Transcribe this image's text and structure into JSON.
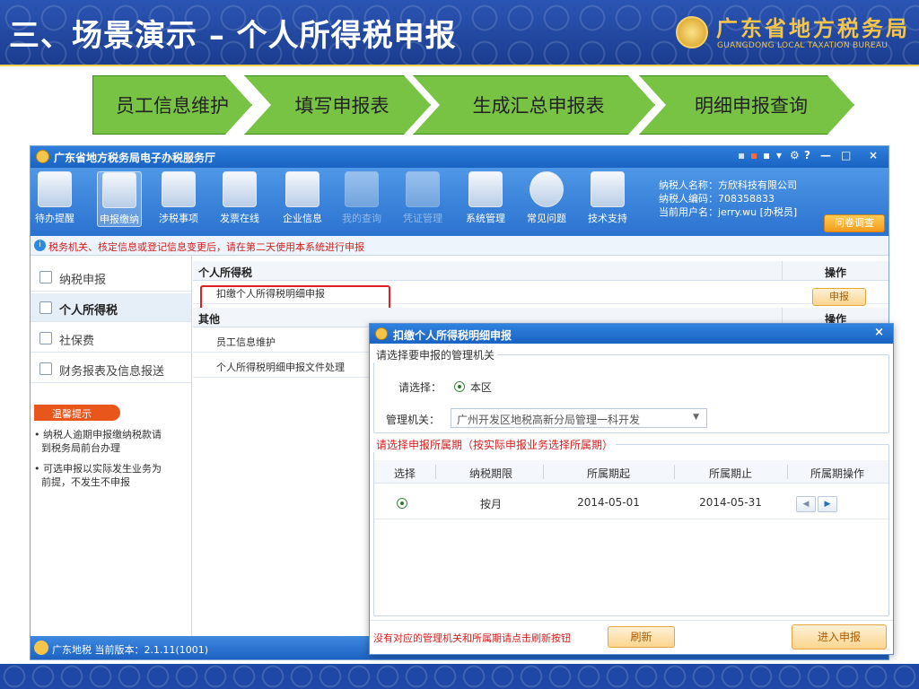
{
  "slide": {
    "title": "三、场景演示 – 个人所得税申报",
    "logo_cn": "广东省地方税务局",
    "logo_en": "GUANGDONG LOCAL TAXATION BUREAU"
  },
  "steps": [
    "员工信息维护",
    "填写申报表",
    "生成汇总申报表",
    "明细申报查询"
  ],
  "app": {
    "title": "广东省地方税务局电子办税服务厅",
    "window_controls": [
      "▪",
      "▪",
      "▪",
      "▾",
      "⚙",
      "?",
      "—",
      "□",
      "×"
    ],
    "toolbar": [
      {
        "label": "待办提醒",
        "icon": "clipboard-icon",
        "dim": false
      },
      {
        "label": "申报缴纳",
        "icon": "computer-icon",
        "dim": false,
        "active": true
      },
      {
        "label": "涉税事项",
        "icon": "document-icon",
        "dim": false
      },
      {
        "label": "发票在线",
        "icon": "stamp-icon",
        "dim": false
      },
      {
        "label": "企业信息",
        "icon": "building-icon",
        "dim": false
      },
      {
        "label": "我的查询",
        "icon": "magnifier-icon",
        "dim": true
      },
      {
        "label": "凭证管理",
        "icon": "folders-icon",
        "dim": true
      },
      {
        "label": "系统管理",
        "icon": "gear-icon",
        "dim": false
      },
      {
        "label": "常见问题",
        "icon": "question-icon",
        "dim": false
      },
      {
        "label": "技术支持",
        "icon": "support-agent-icon",
        "dim": false
      }
    ],
    "user_info": {
      "name_line": "纳税人名称：方欣科技有限公司",
      "code_line": "纳税人编码：708358833",
      "user_line": "当前用户名：jerry.wu [办税员]"
    },
    "survey_label": "问卷调查",
    "notice": "税务机关、核定信息或登记信息变更后，请在第二天使用本系统进行申报",
    "sidebar": [
      "纳税申报",
      "个人所得税",
      "社保费",
      "财务报表及信息报送"
    ],
    "tips": {
      "title": "温馨提示",
      "lines": [
        "• 纳税人逾期申报缴纳税款请",
        "到税务局前台办理",
        "• 可选申报以实际发生业务为",
        "前提，不发生不申报"
      ]
    },
    "main": {
      "section1": "个人所得税",
      "op_header": "操作",
      "row1": "扣缴个人所得税明细申报",
      "declare_label": "申报",
      "section2": "其他",
      "op_header2": "操作",
      "row2": "员工信息维护",
      "row3": "个人所得税明细申报文件处理"
    },
    "status": {
      "text": "广东地税  当前版本：2.1.11(1001)"
    }
  },
  "dialog": {
    "title": "扣缴个人所得税明细申报",
    "section1_legend": "请选择要申报的管理机关",
    "select_label": "请选择：",
    "radio_label": "本区",
    "org_label": "管理机关：",
    "org_value": "广州开发区地税高新分局管理一科开发",
    "section2_legend": "请选择申报所属期（按实际申报业务选择所属期）",
    "columns": [
      "选择",
      "纳税期限",
      "所属期起",
      "所属期止",
      "所属期操作"
    ],
    "rows": [
      {
        "period": "按月",
        "start": "2014-05-01",
        "end": "2014-05-31"
      }
    ],
    "footer_hint": "没有对应的管理机关和所属期请点击刷新按钮",
    "refresh_label": "刷新",
    "enter_label": "进入申报"
  }
}
